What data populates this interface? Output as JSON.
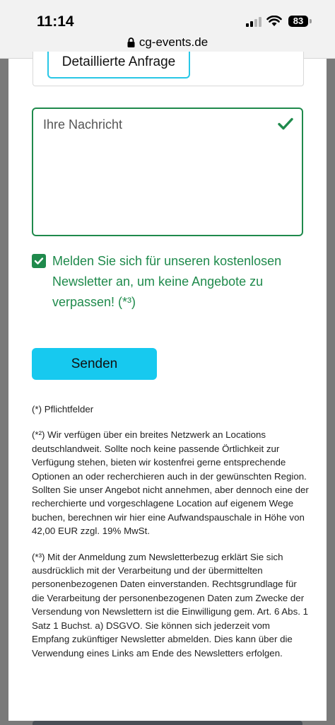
{
  "status_bar": {
    "time": "11:14",
    "battery": "83",
    "url": "cg-events.de"
  },
  "form": {
    "prev_button_label": "Detaillierte Anfrage",
    "message_placeholder": "Ihre Nachricht",
    "newsletter_label": "Melden Sie sich für unseren kostenlosen Newsletter an, um keine Angebote zu verpassen! (*³)",
    "newsletter_checked": true,
    "submit_label": "Senden"
  },
  "notes": {
    "required": "(*) Pflichtfelder",
    "note2": "(*²) Wir verfügen über ein breites Netzwerk an Locations deutschlandweit. Sollte noch keine passende Örtlichkeit zur Verfügung stehen, bieten wir kostenfrei gerne entsprechende Optionen an oder recherchieren auch in der gewünschten Region. Sollten Sie unser Angebot nicht annehmen, aber dennoch eine der recherchierte und vorgeschlagene Location auf eigenem Wege buchen, berechnen wir hier eine Aufwandspauschale in Höhe von 42,00 EUR zzgl. 19% MwSt.",
    "note3": "(*³) Mit der Anmeldung zum Newsletterbezug erklärt Sie sich ausdrücklich mit der Verarbeitung und der übermittelten personenbezogenen Daten einverstanden. Rechtsgrundlage für die Verarbeitung der personenbezogenen Daten zum Zwecke der Versendung von Newslettern ist die Einwilligung gem. Art. 6 Abs. 1 Satz 1 Buchst. a) DSGVO. Sie können sich jederzeit vom Empfang zukünftiger Newsletter abmelden. Dies kann über die Verwendung eines Links am Ende des Newsletters erfolgen."
  },
  "colors": {
    "accent_green": "#1f8a4c",
    "button_cyan": "#17c9ef"
  }
}
